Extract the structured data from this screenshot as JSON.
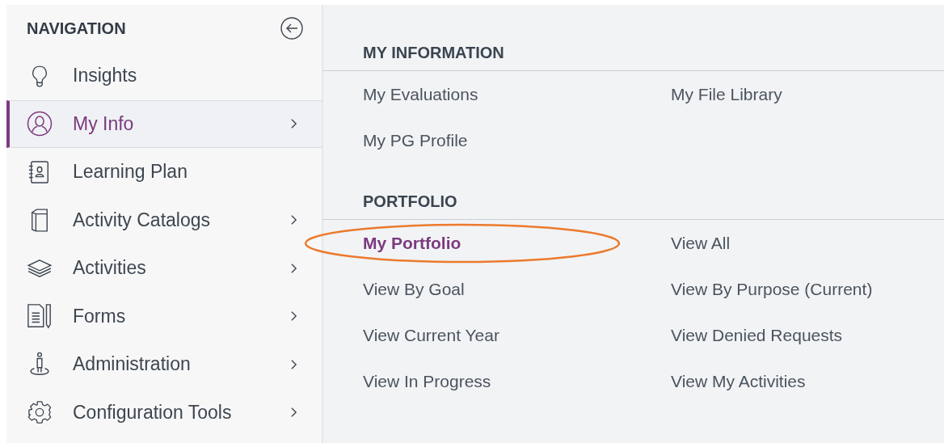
{
  "navigation": {
    "title": "NAVIGATION",
    "items": [
      {
        "label": "Insights",
        "selected": false,
        "has_submenu": false
      },
      {
        "label": "My Info",
        "selected": true,
        "has_submenu": true
      },
      {
        "label": "Learning Plan",
        "selected": false,
        "has_submenu": false
      },
      {
        "label": "Activity Catalogs",
        "selected": false,
        "has_submenu": true
      },
      {
        "label": "Activities",
        "selected": false,
        "has_submenu": true
      },
      {
        "label": "Forms",
        "selected": false,
        "has_submenu": true
      },
      {
        "label": "Administration",
        "selected": false,
        "has_submenu": true
      },
      {
        "label": "Configuration Tools",
        "selected": false,
        "has_submenu": true
      }
    ]
  },
  "sections": [
    {
      "title": "MY INFORMATION",
      "links": [
        {
          "label": "My Evaluations",
          "selected": false,
          "circled": false
        },
        {
          "label": "My File Library",
          "selected": false,
          "circled": false
        },
        {
          "label": "My PG Profile",
          "selected": false,
          "circled": false
        }
      ]
    },
    {
      "title": "PORTFOLIO",
      "links": [
        {
          "label": "My Portfolio",
          "selected": true,
          "circled": true
        },
        {
          "label": "View All",
          "selected": false,
          "circled": false
        },
        {
          "label": "View By Goal",
          "selected": false,
          "circled": false
        },
        {
          "label": "View By Purpose (Current)",
          "selected": false,
          "circled": false
        },
        {
          "label": "View Current Year",
          "selected": false,
          "circled": false
        },
        {
          "label": "View Denied Requests",
          "selected": false,
          "circled": false
        },
        {
          "label": "View In Progress",
          "selected": false,
          "circled": false
        },
        {
          "label": "View My Activities",
          "selected": false,
          "circled": false
        }
      ]
    }
  ]
}
